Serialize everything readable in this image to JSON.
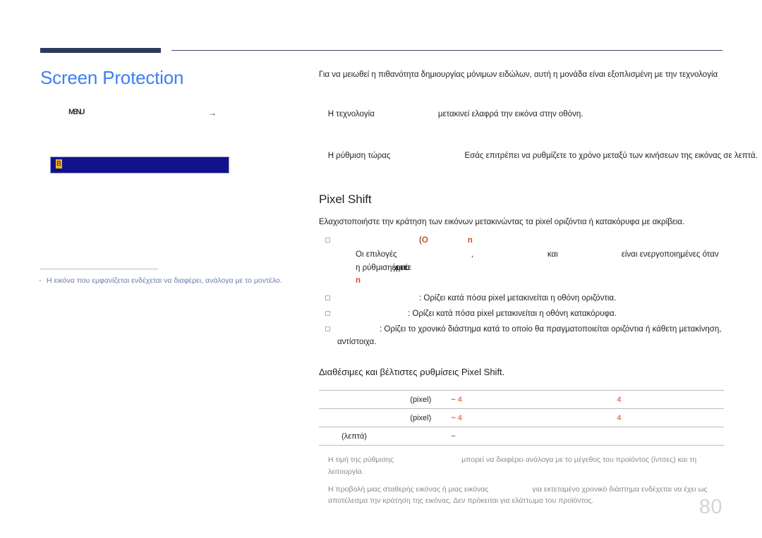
{
  "header": {
    "rule_color": "#2e3a5c",
    "accent_blue": "#3d7ff2"
  },
  "left": {
    "title": "Screen Protection",
    "breadcrumb": {
      "glyph": "MENU",
      "arrow": "→"
    },
    "menu_bar": {
      "glyph": "B",
      "background": "#12128c",
      "glyph_color": "#f5b31b"
    },
    "note_dash": "-",
    "note": "Η εικόνα που εμφανίζεται ενδέχεται να διαφέρει, ανάλογα με το μοντέλο."
  },
  "right": {
    "intro": "Για να μειωθεί η πιθανότητα δημιουργίας μόνιμων ειδώλων, αυτή η μονάδα είναι εξοπλισμένη με την τεχνολογία",
    "line2_a": "Η τεχνολογία",
    "line2_b": "μετακινεί ελαφρά την εικόνα στην οθόνη.",
    "line3_a": "Η ρύθμιση τώρας",
    "line3_b": "Εσάς επιτρέπει να ρυθμίζετε το χρόνο μεταξύ των κινήσεων της εικόνας σε λεπτά.",
    "section_title": "Pixel Shift",
    "section_desc": "Ελαχιστοποιήστε την κράτηση των εικόνων μετακινώντας τα pixel οριζόντια ή κατακόρυφα με ακρίβεια.",
    "bullet0": {
      "paren": "(",
      "mark1": "O",
      "mark2": "n"
    },
    "subnote": {
      "a": "Οι επιλογές",
      "comma": ",",
      "b": "και",
      "c": "είναι ενεργοποιημένες όταν η ρύθμιση",
      "d": "έχει οριστεί σε",
      "mark": "n"
    },
    "bullets": [
      ": Ορίζει κατά πόσα pixel μετακινείται η οθόνη οριζόντια.",
      ": Ορίζει κατά πόσα pixel μετακινείται η οθόνη κατακόρυφα.",
      ": Ορίζει το χρονικό διάστημα κατά το οποίο θα πραγματοποιείται οριζόντια ή κάθετη μετακίνηση,"
    ],
    "bullet3_cont": "αντίστοιχα.",
    "table_title": "Διαθέσιμες και βέλτιστες ρυθμίσεις Pixel Shift."
  },
  "table": {
    "rows": [
      {
        "label": "(pixel)",
        "mid_tilde": "~",
        "mid_value": "4",
        "right_value": "4"
      },
      {
        "label": "(pixel)",
        "mid_tilde": "~",
        "mid_value": "4",
        "right_value": "4"
      },
      {
        "label": "(λεπτά)",
        "mid_tilde": "~",
        "mid_value": "",
        "right_value": ""
      }
    ]
  },
  "footnotes": [
    {
      "a": "Η τιμή της ρύθμισης",
      "b": "μπορεί να διαφέρει ανάλογα με το μέγεθος του προϊόντος (ίντσες) και τη λειτουργία."
    },
    {
      "a": "Η προβολή μιας σταθερής εικόνας ή μιας εικόνας",
      "b": "για εκτεταμένο χρονικό διάστημα ενδέχεται να έχει ως αποτέλεσμα την κράτηση της εικόνας. Δεν πρόκειται για ελάττωμα του προϊόντος."
    }
  ],
  "page_number": "80"
}
